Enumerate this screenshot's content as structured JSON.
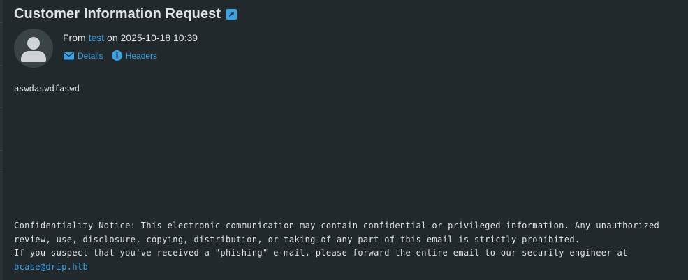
{
  "message": {
    "subject": "Customer Information Request",
    "from_prefix": "From",
    "from_name": "test",
    "date_prefix": "on",
    "date": "2025-10-18 10:39",
    "details_label": "Details",
    "headers_label": "Headers",
    "body": "aswdaswdfaswd",
    "notice_line1": "Confidentiality Notice: This electronic communication may contain confidential or privileged information. Any unauthorized",
    "notice_line2": "review, use, disclosure, copying, distribution, or taking of any part of this email is strictly prohibited.",
    "notice_line3": "If you suspect that you've received a \"phishing\" e-mail, please forward the entire email to our security engineer at",
    "notice_email": "bcase@drip.htb"
  },
  "icons": {
    "external": "external-link-icon",
    "avatar": "person-avatar",
    "details": "envelope-icon",
    "headers": "info-circle-icon"
  },
  "colors": {
    "background": "#22292c",
    "text": "#dfe3e6",
    "accent": "#39a5e6",
    "avatar_bg": "#3a4448",
    "avatar_fg": "#cfd3d5"
  }
}
